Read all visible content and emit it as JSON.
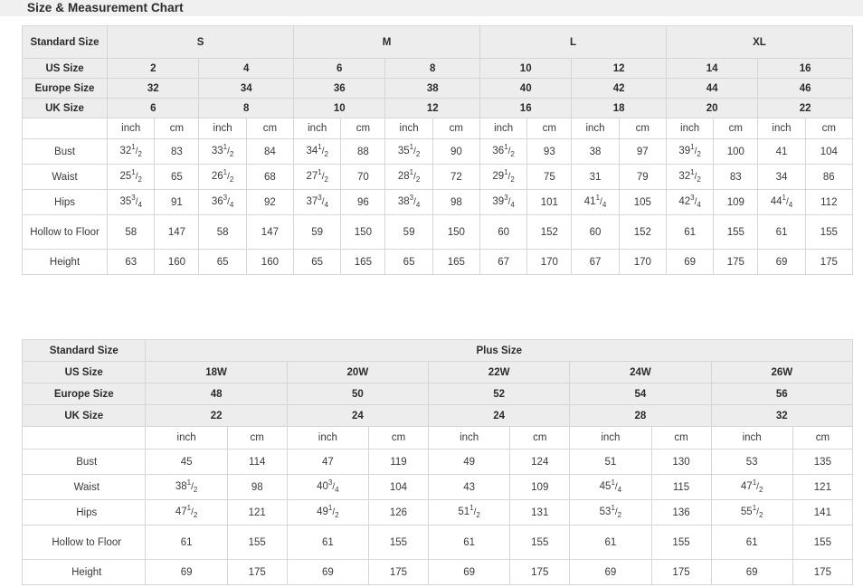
{
  "page": {
    "title": "Size & Measurement Chart"
  },
  "table1": {
    "label_standard_size": "Standard Size",
    "label_us_size": "US Size",
    "label_europe_size": "Europe Size",
    "label_uk_size": "UK Size",
    "groups": [
      "S",
      "M",
      "L",
      "XL"
    ],
    "us_sizes": [
      "2",
      "4",
      "6",
      "8",
      "10",
      "12",
      "14",
      "16"
    ],
    "europe_sizes": [
      "32",
      "34",
      "36",
      "38",
      "40",
      "42",
      "44",
      "46"
    ],
    "uk_sizes": [
      "6",
      "8",
      "10",
      "12",
      "16",
      "18",
      "20",
      "22"
    ],
    "unit_inch": "inch",
    "unit_cm": "cm",
    "rows": [
      {
        "name": "Bust",
        "inch": [
          "32 1/2",
          "33 1/2",
          "34 1/2",
          "35 1/2",
          "36 1/2",
          "38",
          "39 1/2",
          "41"
        ],
        "cm": [
          "83",
          "84",
          "88",
          "90",
          "93",
          "97",
          "100",
          "104"
        ]
      },
      {
        "name": "Waist",
        "inch": [
          "25 1/2",
          "26 1/2",
          "27 1/2",
          "28 1/2",
          "29 1/2",
          "31",
          "32 1/2",
          "34"
        ],
        "cm": [
          "65",
          "68",
          "70",
          "72",
          "75",
          "79",
          "83",
          "86"
        ]
      },
      {
        "name": "Hips",
        "inch": [
          "35 3/4",
          "36 3/4",
          "37 3/4",
          "38 3/4",
          "39 3/4",
          "41 1/4",
          "42 3/4",
          "44 1/4"
        ],
        "cm": [
          "91",
          "92",
          "96",
          "98",
          "101",
          "105",
          "109",
          "112"
        ]
      },
      {
        "name": "Hollow to Floor",
        "inch": [
          "58",
          "58",
          "59",
          "59",
          "60",
          "60",
          "61",
          "61"
        ],
        "cm": [
          "147",
          "147",
          "150",
          "150",
          "152",
          "152",
          "155",
          "155"
        ]
      },
      {
        "name": "Height",
        "inch": [
          "63",
          "65",
          "65",
          "65",
          "67",
          "67",
          "69",
          "69"
        ],
        "cm": [
          "160",
          "160",
          "165",
          "165",
          "170",
          "170",
          "175",
          "175"
        ]
      }
    ]
  },
  "table2": {
    "label_standard_size": "Standard Size",
    "label_plus_size": "Plus Size",
    "label_us_size": "US Size",
    "label_europe_size": "Europe Size",
    "label_uk_size": "UK Size",
    "us_sizes": [
      "18W",
      "20W",
      "22W",
      "24W",
      "26W"
    ],
    "europe_sizes": [
      "48",
      "50",
      "52",
      "54",
      "56"
    ],
    "uk_sizes": [
      "22",
      "24",
      "24",
      "28",
      "32"
    ],
    "unit_inch": "inch",
    "unit_cm": "cm",
    "rows": [
      {
        "name": "Bust",
        "inch": [
          "45",
          "47",
          "49",
          "51",
          "53"
        ],
        "cm": [
          "114",
          "119",
          "124",
          "130",
          "135"
        ]
      },
      {
        "name": "Waist",
        "inch": [
          "38 1/2",
          "40 3/4",
          "43",
          "45 1/4",
          "47 1/2"
        ],
        "cm": [
          "98",
          "104",
          "109",
          "115",
          "121"
        ]
      },
      {
        "name": "Hips",
        "inch": [
          "47 1/2",
          "49 1/2",
          "51 1/2",
          "53 1/2",
          "55 1/2"
        ],
        "cm": [
          "121",
          "126",
          "131",
          "136",
          "141"
        ]
      },
      {
        "name": "Hollow to Floor",
        "inch": [
          "61",
          "61",
          "61",
          "61",
          "61"
        ],
        "cm": [
          "155",
          "155",
          "155",
          "155",
          "155"
        ]
      },
      {
        "name": "Height",
        "inch": [
          "69",
          "69",
          "69",
          "69",
          "69"
        ],
        "cm": [
          "175",
          "175",
          "175",
          "175",
          "175"
        ]
      }
    ]
  },
  "colors": {
    "header_band": "#f0f0f0",
    "cell_header": "#ededed",
    "border": "#d6d6d6",
    "text": "#3a3a3a"
  }
}
